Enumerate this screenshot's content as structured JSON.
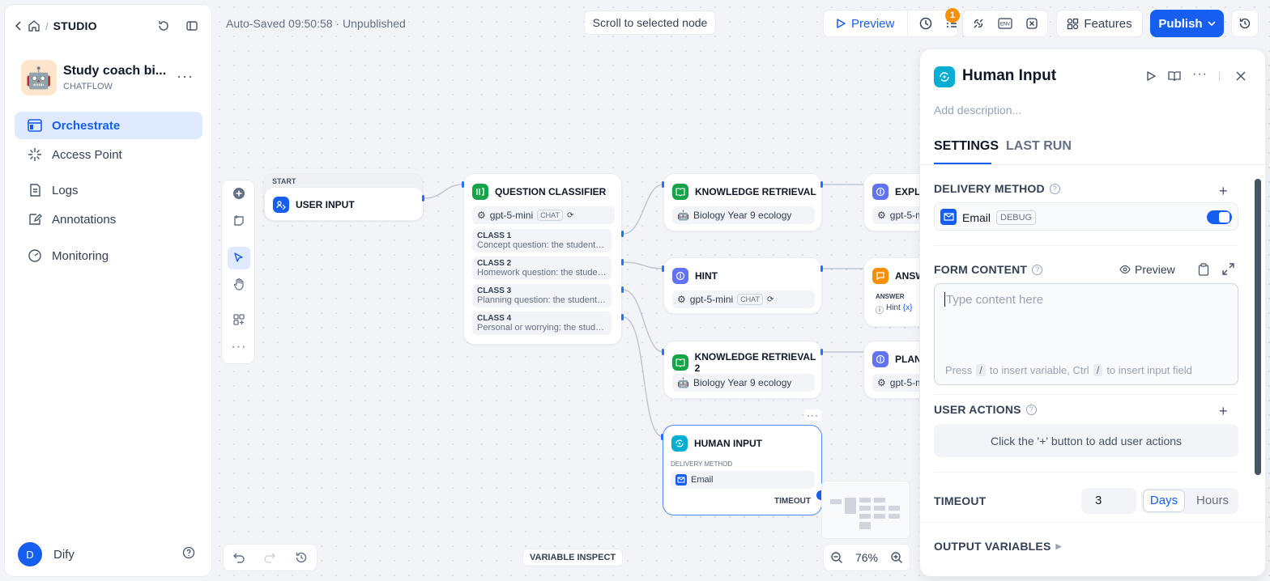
{
  "breadcrumb": {
    "label": "STUDIO"
  },
  "app": {
    "name": "Study coach bi...",
    "type": "CHATFLOW"
  },
  "nav": [
    {
      "label": "Orchestrate"
    },
    {
      "label": "Access Point"
    },
    {
      "label": "Logs"
    },
    {
      "label": "Annotations"
    },
    {
      "label": "Monitoring"
    }
  ],
  "user": {
    "initial": "D",
    "name": "Dify"
  },
  "topbar": {
    "status": "Auto-Saved 09:50:58 · Unpublished",
    "scroll_btn": "Scroll to selected node",
    "preview": "Preview",
    "badge": "1",
    "features": "Features",
    "publish": "Publish"
  },
  "nodes": {
    "start": {
      "tag": "START",
      "title": "USER INPUT"
    },
    "classifier": {
      "title": "QUESTION CLASSIFIER",
      "model": "gpt-5-mini",
      "model_tag": "CHAT",
      "classes": [
        {
          "name": "CLASS 1",
          "desc": "Concept question: the student wa..."
        },
        {
          "name": "CLASS 2",
          "desc": "Homework question: the student ..."
        },
        {
          "name": "CLASS 3",
          "desc": "Planning question: the student as..."
        },
        {
          "name": "CLASS 4",
          "desc": "Personal or worrying: the student ..."
        }
      ]
    },
    "kr1": {
      "title": "KNOWLEDGE RETRIEVAL",
      "dataset": "Biology Year 9 ecology"
    },
    "hint": {
      "title": "HINT",
      "model": "gpt-5-mini",
      "model_tag": "CHAT"
    },
    "kr2": {
      "title": "KNOWLEDGE RETRIEVAL 2",
      "dataset": "Biology Year 9 ecology"
    },
    "human": {
      "title": "HUMAN INPUT",
      "delivery_label": "DELIVERY METHOD",
      "delivery": "Email",
      "timeout": "TIMEOUT"
    },
    "expla": {
      "title": "EXPLA",
      "model": "gpt-5-m"
    },
    "answ": {
      "title": "ANSW",
      "sub": "ANSWER",
      "ref1": "Hint",
      "ref2": "{x}"
    },
    "plann": {
      "title": "PLANN",
      "model": "gpt-5-m"
    }
  },
  "bottom": {
    "variable_inspect": "VARIABLE INSPECT",
    "zoom": "76%"
  },
  "panel": {
    "title": "Human Input",
    "description_placeholder": "Add description...",
    "tabs": [
      "SETTINGS",
      "LAST RUN"
    ],
    "delivery": {
      "label": "DELIVERY METHOD",
      "method": "Email",
      "tag": "DEBUG",
      "enabled": true
    },
    "form": {
      "label": "FORM CONTENT",
      "preview": "Preview",
      "placeholder": "Type content here",
      "hint_press": "Press",
      "hint_slash1": "/",
      "hint_mid": "to insert variable, Ctrl",
      "hint_slash2": "/",
      "hint_end": "to insert input field"
    },
    "actions": {
      "label": "USER ACTIONS",
      "empty": "Click the '+' button to add user actions"
    },
    "timeout": {
      "label": "TIMEOUT",
      "value": "3",
      "units": [
        "Days",
        "Hours"
      ],
      "selected": "Days"
    },
    "output": {
      "label": "OUTPUT VARIABLES"
    }
  },
  "colors": {
    "accent": "#155eef",
    "classifier": "#16a34a",
    "retrieval": "#16a34a",
    "llm": "#6172f3",
    "answer": "#f79009",
    "human": "#06aed4"
  }
}
